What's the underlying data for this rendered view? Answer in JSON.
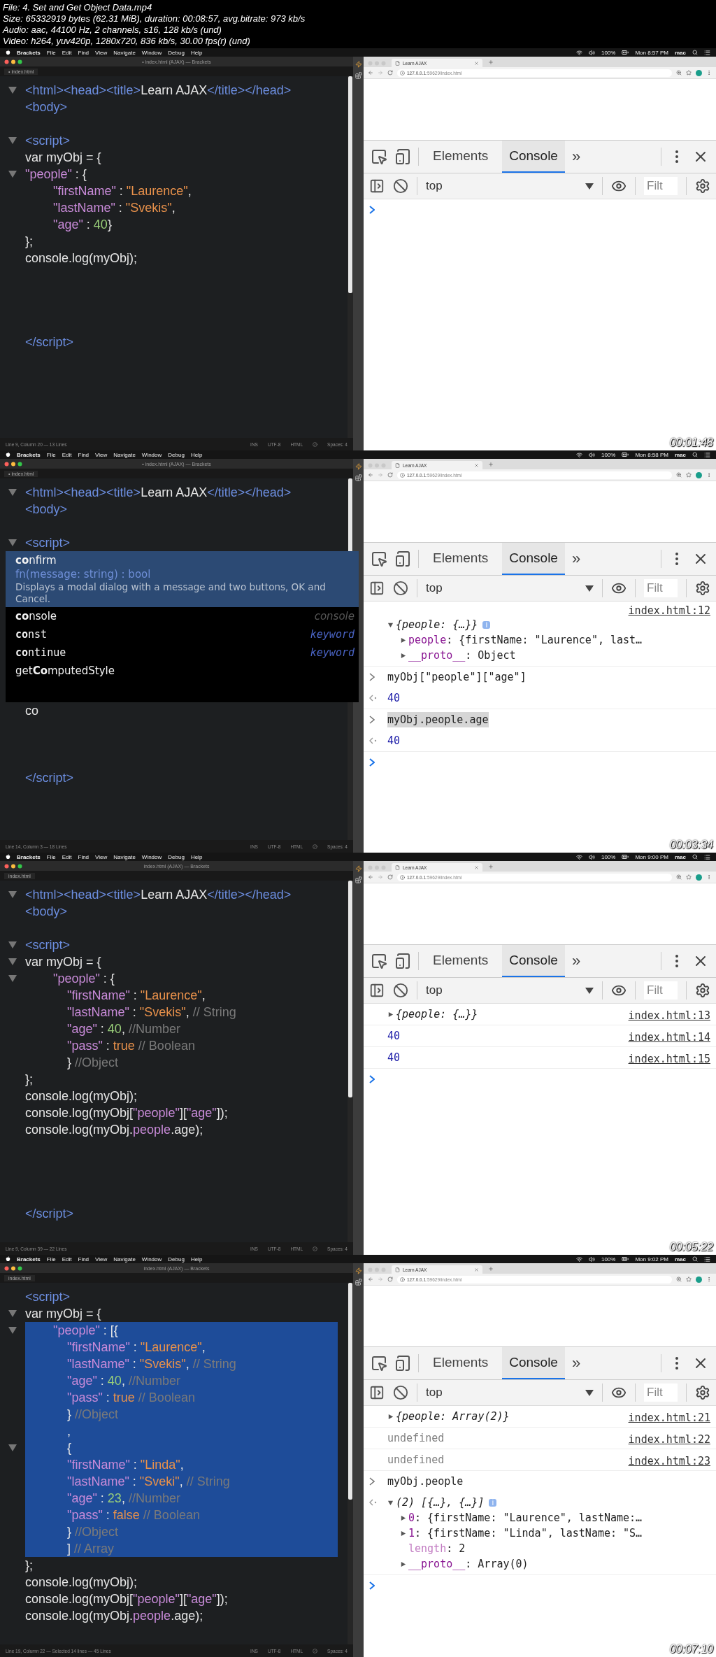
{
  "header": [
    "File: 4. Set and Get Object Data.mp4",
    "Size: 65332919 bytes (62.31 MiB), duration: 00:08:57, avg.bitrate: 973 kb/s",
    "Audio: aac, 44100 Hz, 2 channels, s16, 128 kb/s (und)",
    "Video: h264, yuv420p, 1280x720, 836 kb/s, 30.00 fps(r) (und)"
  ],
  "frames": [
    {
      "menu_bar": {
        "app": "Brackets",
        "menus": [
          "File",
          "Edit",
          "Find",
          "View",
          "Navigate",
          "Window",
          "Debug",
          "Help"
        ],
        "battery": "100%",
        "clock": "Mon 8:57 PM",
        "user": "mac"
      },
      "editor": {
        "title": "• index.html (AJAX) — Brackets",
        "tab": "• index.html",
        "lines": [
          {
            "kind": "code",
            "fold": true,
            "selected": false,
            "tokens": [
              {
                "kind": "tag",
                "text": "<html><head><title>"
              },
              {
                "kind": "text",
                "text": "Learn AJAX"
              },
              {
                "kind": "tag",
                "text": "</title></head>"
              }
            ]
          },
          {
            "kind": "code",
            "fold": false,
            "selected": false,
            "tokens": [
              {
                "kind": "tag",
                "text": "<body>"
              }
            ]
          },
          {
            "kind": "blank"
          },
          {
            "kind": "code",
            "fold": true,
            "selected": false,
            "tokens": [
              {
                "kind": "tag",
                "text": "<script>"
              }
            ]
          },
          {
            "kind": "code",
            "fold": false,
            "selected": false,
            "tokens": [
              {
                "kind": "text",
                "text": "var myObj = {"
              }
            ]
          },
          {
            "kind": "code",
            "fold": true,
            "selected": false,
            "tokens": [
              {
                "kind": "key",
                "text": "\"people\""
              },
              {
                "kind": "text",
                "text": " : {"
              }
            ]
          },
          {
            "kind": "code",
            "fold": false,
            "selected": false,
            "tokens": [
              {
                "kind": "key",
                "text": "        \"firstName\""
              },
              {
                "kind": "text",
                "text": " : "
              },
              {
                "kind": "string",
                "text": "\"Laurence\""
              },
              {
                "kind": "text",
                "text": ","
              }
            ]
          },
          {
            "kind": "code",
            "fold": false,
            "selected": false,
            "tokens": [
              {
                "kind": "key",
                "text": "        \"lastName\""
              },
              {
                "kind": "text",
                "text": " : "
              },
              {
                "kind": "string",
                "text": "\"Svekis\""
              },
              {
                "kind": "text",
                "text": ","
              }
            ]
          },
          {
            "kind": "code",
            "fold": false,
            "selected": false,
            "tokens": [
              {
                "kind": "key",
                "text": "        \"age\""
              },
              {
                "kind": "text",
                "text": " : "
              },
              {
                "kind": "number",
                "text": "40"
              },
              {
                "kind": "text",
                "text": "}"
              }
            ]
          },
          {
            "kind": "code",
            "fold": false,
            "selected": false,
            "tokens": [
              {
                "kind": "text",
                "text": "};"
              }
            ]
          },
          {
            "kind": "code",
            "fold": false,
            "selected": false,
            "tokens": [
              {
                "kind": "text",
                "text": "console.log(myObj);"
              }
            ]
          },
          {
            "kind": "blank"
          },
          {
            "kind": "blank"
          },
          {
            "kind": "blank"
          },
          {
            "kind": "blank"
          },
          {
            "kind": "code",
            "fold": false,
            "selected": false,
            "tokens": [
              {
                "kind": "tag",
                "text": "</script>"
              }
            ]
          }
        ],
        "status": {
          "position": "Line 9, Column 20 — 13 Lines",
          "mode": "INS",
          "encoding": "UTF-8",
          "language": "HTML",
          "indent": "Spaces: 4"
        }
      },
      "browser": {
        "tab": "Learn AJAX",
        "address": "**127.0.0.1**:59629/index.html"
      },
      "devtools": {
        "tabs": [
          {
            "label": "Elements",
            "selected": false
          },
          {
            "label": "Console",
            "selected": true
          }
        ],
        "more": "»",
        "context": "top",
        "filter_placeholder": "Filt",
        "entries": [
          {
            "kind": "prompt"
          }
        ]
      },
      "timestamp": "00:01:48"
    },
    {
      "menu_bar": {
        "app": "Brackets",
        "menus": [
          "File",
          "Edit",
          "Find",
          "View",
          "Navigate",
          "Window",
          "Debug",
          "Help"
        ],
        "battery": "100%",
        "clock": "Mon 8:58 PM",
        "user": "mac"
      },
      "editor": {
        "title": "• index.html (AJAX) — Brackets",
        "tab": "• index.html",
        "lines": [
          {
            "kind": "code",
            "fold": true,
            "selected": false,
            "tokens": [
              {
                "kind": "tag",
                "text": "<html><head><title>"
              },
              {
                "kind": "text",
                "text": "Learn AJAX"
              },
              {
                "kind": "tag",
                "text": "</title></head>"
              }
            ]
          },
          {
            "kind": "code",
            "fold": false,
            "selected": false,
            "tokens": [
              {
                "kind": "tag",
                "text": "<body>"
              }
            ]
          },
          {
            "kind": "blank"
          },
          {
            "kind": "code",
            "fold": true,
            "selected": false,
            "tokens": [
              {
                "kind": "tag",
                "text": "<script>"
              }
            ]
          },
          {
            "kind": "blank"
          },
          {
            "kind": "blank"
          },
          {
            "kind": "blank"
          },
          {
            "kind": "blank"
          },
          {
            "kind": "blank"
          },
          {
            "kind": "blank"
          },
          {
            "kind": "blank"
          },
          {
            "kind": "blank"
          },
          {
            "kind": "blank"
          },
          {
            "kind": "code",
            "fold": false,
            "selected": false,
            "tokens": [
              {
                "kind": "text",
                "text": "co"
              }
            ]
          },
          {
            "kind": "blank"
          },
          {
            "kind": "blank"
          },
          {
            "kind": "blank"
          },
          {
            "kind": "code",
            "fold": false,
            "selected": false,
            "tokens": [
              {
                "kind": "tag",
                "text": "</script>"
              }
            ]
          }
        ],
        "hints": [
          {
            "label": "**co**nfirm",
            "kind": "function",
            "selected": true,
            "signature": "fn(message: string) : bool",
            "doc": "Displays a modal dialog with a message and two buttons, OK and Cancel."
          },
          {
            "label": "**co**nsole",
            "kind": "variable",
            "selected": false,
            "type": "console"
          },
          {
            "label": "**co**nst",
            "kind": "keyword",
            "selected": false,
            "type": "keyword"
          },
          {
            "label": "**co**ntinue",
            "kind": "keyword",
            "selected": false,
            "type": "keyword"
          },
          {
            "label": "get**Co**mputedStyle",
            "kind": "function",
            "selected": false
          }
        ],
        "status": {
          "position": "Line 14, Column 3 — 18 Lines",
          "mode": "INS",
          "encoding": "UTF-8",
          "language": "HTML",
          "indent": "Spaces: 4"
        }
      },
      "browser": {
        "tab": "Learn AJAX",
        "address": "**127.0.0.1**:59629/index.html"
      },
      "devtools": {
        "tabs": [
          {
            "label": "Elements",
            "selected": false
          },
          {
            "label": "Console",
            "selected": true
          }
        ],
        "more": "»",
        "context": "top",
        "filter_placeholder": "Filt",
        "entries": [
          {
            "kind": "log",
            "source": "index.html:12",
            "node": {
              "kind": "object",
              "text": "{people: {…}}",
              "expanded": true,
              "badge": "i",
              "children": [
                {
                  "kind": "property",
                  "key": "people",
                  "text": ": {firstName: \"Laurence\", last…",
                  "expanded": false
                },
                {
                  "kind": "property",
                  "key": "__proto__",
                  "text": ": Object",
                  "expanded": false
                }
              ]
            }
          },
          {
            "kind": "input",
            "text": "myObj[\"people\"][\"age\"]",
            "highlighted": false
          },
          {
            "kind": "result",
            "node": {
              "kind": "number",
              "text": "40"
            }
          },
          {
            "kind": "input",
            "text": "myObj.people.age",
            "highlighted": true
          },
          {
            "kind": "result",
            "node": {
              "kind": "number",
              "text": "40"
            }
          },
          {
            "kind": "prompt"
          }
        ]
      },
      "timestamp": "00:03:34"
    },
    {
      "menu_bar": {
        "app": "Brackets",
        "menus": [
          "File",
          "Edit",
          "Find",
          "View",
          "Navigate",
          "Window",
          "Debug",
          "Help"
        ],
        "battery": "100%",
        "clock": "Mon 9:00 PM",
        "user": "mac"
      },
      "editor": {
        "title": "index.html (AJAX) — Brackets",
        "tab": "index.html",
        "lines": [
          {
            "kind": "code",
            "fold": true,
            "selected": false,
            "tokens": [
              {
                "kind": "tag",
                "text": "<html><head><title>"
              },
              {
                "kind": "text",
                "text": "Learn AJAX"
              },
              {
                "kind": "tag",
                "text": "</title></head>"
              }
            ]
          },
          {
            "kind": "code",
            "fold": false,
            "selected": false,
            "tokens": [
              {
                "kind": "tag",
                "text": "<body>"
              }
            ]
          },
          {
            "kind": "blank"
          },
          {
            "kind": "code",
            "fold": true,
            "selected": false,
            "tokens": [
              {
                "kind": "tag",
                "text": "<script>"
              }
            ]
          },
          {
            "kind": "code",
            "fold": true,
            "selected": false,
            "tokens": [
              {
                "kind": "text",
                "text": "var myObj = {"
              }
            ]
          },
          {
            "kind": "code",
            "fold": true,
            "selected": false,
            "tokens": [
              {
                "kind": "key",
                "text": "        \"people\""
              },
              {
                "kind": "text",
                "text": " : {"
              }
            ]
          },
          {
            "kind": "code",
            "fold": false,
            "selected": false,
            "tokens": [
              {
                "kind": "key",
                "text": "            \"firstName\""
              },
              {
                "kind": "text",
                "text": " : "
              },
              {
                "kind": "string",
                "text": "\"Laurence\""
              },
              {
                "kind": "text",
                "text": ","
              }
            ]
          },
          {
            "kind": "code",
            "fold": false,
            "selected": false,
            "tokens": [
              {
                "kind": "key",
                "text": "            \"lastName\""
              },
              {
                "kind": "text",
                "text": " : "
              },
              {
                "kind": "string",
                "text": "\"Svekis\""
              },
              {
                "kind": "text",
                "text": ", "
              },
              {
                "kind": "comment",
                "text": "// String"
              }
            ]
          },
          {
            "kind": "code",
            "fold": false,
            "selected": false,
            "tokens": [
              {
                "kind": "key",
                "text": "            \"age\""
              },
              {
                "kind": "text",
                "text": " : "
              },
              {
                "kind": "number",
                "text": "40"
              },
              {
                "kind": "text",
                "text": ", "
              },
              {
                "kind": "comment",
                "text": "//Number"
              }
            ]
          },
          {
            "kind": "code",
            "fold": false,
            "selected": false,
            "tokens": [
              {
                "kind": "key",
                "text": "            \"pass\""
              },
              {
                "kind": "text",
                "text": " : "
              },
              {
                "kind": "atom",
                "text": "true"
              },
              {
                "kind": "comment",
                "text": " // Boolean"
              }
            ]
          },
          {
            "kind": "code",
            "fold": false,
            "selected": false,
            "tokens": [
              {
                "kind": "text",
                "text": "            } "
              },
              {
                "kind": "comment",
                "text": "//Object"
              }
            ]
          },
          {
            "kind": "code",
            "fold": false,
            "selected": false,
            "tokens": [
              {
                "kind": "text",
                "text": "};"
              }
            ]
          },
          {
            "kind": "code",
            "fold": false,
            "selected": false,
            "tokens": [
              {
                "kind": "text",
                "text": "console.log(myObj);"
              }
            ]
          },
          {
            "kind": "code",
            "fold": false,
            "selected": false,
            "tokens": [
              {
                "kind": "text",
                "text": "console.log(myObj["
              },
              {
                "kind": "key",
                "text": "\"people\""
              },
              {
                "kind": "text",
                "text": "]["
              },
              {
                "kind": "key",
                "text": "\"age\""
              },
              {
                "kind": "text",
                "text": "]);"
              }
            ]
          },
          {
            "kind": "code",
            "fold": false,
            "selected": false,
            "tokens": [
              {
                "kind": "text",
                "text": "console.log(myObj."
              },
              {
                "kind": "key",
                "text": "people"
              },
              {
                "kind": "text",
                "text": ".age);"
              }
            ]
          },
          {
            "kind": "blank"
          },
          {
            "kind": "blank"
          },
          {
            "kind": "blank"
          },
          {
            "kind": "blank"
          },
          {
            "kind": "code",
            "fold": false,
            "selected": false,
            "tokens": [
              {
                "kind": "tag",
                "text": "</script>"
              }
            ]
          }
        ],
        "status": {
          "position": "Line 9, Column 39 — 22 Lines",
          "mode": "INS",
          "encoding": "UTF-8",
          "language": "HTML",
          "indent": "Spaces: 4"
        }
      },
      "browser": {
        "tab": "Learn AJAX",
        "address": "**127.0.0.1**:59629/index.html"
      },
      "devtools": {
        "tabs": [
          {
            "label": "Elements",
            "selected": false
          },
          {
            "label": "Console",
            "selected": true
          }
        ],
        "more": "»",
        "context": "top",
        "filter_placeholder": "Filt",
        "entries": [
          {
            "kind": "log",
            "source": "index.html:13",
            "node": {
              "kind": "object",
              "text": "{people: {…}}",
              "expanded": false
            }
          },
          {
            "kind": "log",
            "source": "index.html:14",
            "node": {
              "kind": "number",
              "text": "40"
            }
          },
          {
            "kind": "log",
            "source": "index.html:15",
            "node": {
              "kind": "number",
              "text": "40"
            }
          },
          {
            "kind": "prompt"
          }
        ]
      },
      "timestamp": "00:05:22"
    },
    {
      "menu_bar": {
        "app": "Brackets",
        "menus": [
          "File",
          "Edit",
          "Find",
          "View",
          "Navigate",
          "Window",
          "Debug",
          "Help"
        ],
        "battery": "100%",
        "clock": "Mon 9:02 PM",
        "user": "mac"
      },
      "editor": {
        "title": "index.html (AJAX) — Brackets",
        "tab": "index.html",
        "lines": [
          {
            "kind": "code",
            "fold": false,
            "selected": false,
            "tokens": [
              {
                "kind": "tag",
                "text": "<script>"
              }
            ]
          },
          {
            "kind": "code",
            "fold": true,
            "selected": false,
            "tokens": [
              {
                "kind": "text",
                "text": "var myObj = {"
              }
            ]
          },
          {
            "kind": "code",
            "fold": true,
            "selected": true,
            "tokens": [
              {
                "kind": "key",
                "text": "        \"people\""
              },
              {
                "kind": "text",
                "text": " : [{"
              }
            ]
          },
          {
            "kind": "code",
            "fold": false,
            "selected": true,
            "tokens": [
              {
                "kind": "key",
                "text": "            \"firstName\""
              },
              {
                "kind": "text",
                "text": " : "
              },
              {
                "kind": "string",
                "text": "\"Laurence\""
              },
              {
                "kind": "text",
                "text": ","
              }
            ]
          },
          {
            "kind": "code",
            "fold": false,
            "selected": true,
            "tokens": [
              {
                "kind": "key",
                "text": "            \"lastName\""
              },
              {
                "kind": "text",
                "text": " : "
              },
              {
                "kind": "string",
                "text": "\"Svekis\""
              },
              {
                "kind": "text",
                "text": ", "
              },
              {
                "kind": "comment",
                "text": "// String"
              }
            ]
          },
          {
            "kind": "code",
            "fold": false,
            "selected": true,
            "tokens": [
              {
                "kind": "key",
                "text": "            \"age\""
              },
              {
                "kind": "text",
                "text": " : "
              },
              {
                "kind": "number",
                "text": "40"
              },
              {
                "kind": "text",
                "text": ", "
              },
              {
                "kind": "comment",
                "text": "//Number"
              }
            ]
          },
          {
            "kind": "code",
            "fold": false,
            "selected": true,
            "tokens": [
              {
                "kind": "key",
                "text": "            \"pass\""
              },
              {
                "kind": "text",
                "text": " : "
              },
              {
                "kind": "atom",
                "text": "true"
              },
              {
                "kind": "comment",
                "text": " // Boolean"
              }
            ]
          },
          {
            "kind": "code",
            "fold": false,
            "selected": true,
            "tokens": [
              {
                "kind": "text",
                "text": "            } "
              },
              {
                "kind": "comment",
                "text": "//Object"
              }
            ]
          },
          {
            "kind": "code",
            "fold": false,
            "selected": true,
            "tokens": [
              {
                "kind": "text",
                "text": "            ,"
              }
            ]
          },
          {
            "kind": "code",
            "fold": true,
            "selected": true,
            "tokens": [
              {
                "kind": "text",
                "text": "            {"
              }
            ]
          },
          {
            "kind": "code",
            "fold": false,
            "selected": true,
            "tokens": [
              {
                "kind": "key",
                "text": "            \"firstName\""
              },
              {
                "kind": "text",
                "text": " : "
              },
              {
                "kind": "string",
                "text": "\"Linda\""
              },
              {
                "kind": "text",
                "text": ","
              }
            ]
          },
          {
            "kind": "code",
            "fold": false,
            "selected": true,
            "tokens": [
              {
                "kind": "key",
                "text": "            \"lastName\""
              },
              {
                "kind": "text",
                "text": " : "
              },
              {
                "kind": "string",
                "text": "\"Sveki\""
              },
              {
                "kind": "text",
                "text": ", "
              },
              {
                "kind": "comment",
                "text": "// String"
              }
            ]
          },
          {
            "kind": "code",
            "fold": false,
            "selected": true,
            "tokens": [
              {
                "kind": "key",
                "text": "            \"age\""
              },
              {
                "kind": "text",
                "text": " : "
              },
              {
                "kind": "number",
                "text": "23"
              },
              {
                "kind": "text",
                "text": ", "
              },
              {
                "kind": "comment",
                "text": "//Number"
              }
            ]
          },
          {
            "kind": "code",
            "fold": false,
            "selected": true,
            "tokens": [
              {
                "kind": "key",
                "text": "            \"pass\""
              },
              {
                "kind": "text",
                "text": " : "
              },
              {
                "kind": "atom",
                "text": "false"
              },
              {
                "kind": "comment",
                "text": " // Boolean"
              }
            ]
          },
          {
            "kind": "code",
            "fold": false,
            "selected": true,
            "tokens": [
              {
                "kind": "text",
                "text": "            } "
              },
              {
                "kind": "comment",
                "text": "//Object"
              }
            ]
          },
          {
            "kind": "code",
            "fold": false,
            "selected": true,
            "tokens": [
              {
                "kind": "text",
                "text": "            ] "
              },
              {
                "kind": "comment",
                "text": "// Array"
              }
            ]
          },
          {
            "kind": "code",
            "fold": false,
            "selected": false,
            "tokens": [
              {
                "kind": "text",
                "text": "};"
              }
            ]
          },
          {
            "kind": "code",
            "fold": false,
            "selected": false,
            "tokens": [
              {
                "kind": "text",
                "text": "console.log(myObj);"
              }
            ]
          },
          {
            "kind": "code",
            "fold": false,
            "selected": false,
            "tokens": [
              {
                "kind": "text",
                "text": "console.log(myObj["
              },
              {
                "kind": "key",
                "text": "\"people\""
              },
              {
                "kind": "text",
                "text": "]["
              },
              {
                "kind": "key",
                "text": "\"age\""
              },
              {
                "kind": "text",
                "text": "]);"
              }
            ]
          },
          {
            "kind": "code",
            "fold": false,
            "selected": false,
            "tokens": [
              {
                "kind": "text",
                "text": "console.log(myObj."
              },
              {
                "kind": "key",
                "text": "people"
              },
              {
                "kind": "text",
                "text": ".age);"
              }
            ]
          }
        ],
        "status": {
          "position": "Line 19, Column 22 — Selected 14 lines — 45 Lines",
          "mode": "INS",
          "encoding": "UTF-8",
          "language": "HTML",
          "indent": "Spaces: 4"
        }
      },
      "browser": {
        "tab": "Learn AJAX",
        "address": "**127.0.0.1**:59629/index.html"
      },
      "devtools": {
        "tabs": [
          {
            "label": "Elements",
            "selected": false
          },
          {
            "label": "Console",
            "selected": true
          }
        ],
        "more": "»",
        "context": "top",
        "filter_placeholder": "Filt",
        "entries": [
          {
            "kind": "log",
            "source": "index.html:21",
            "node": {
              "kind": "object",
              "text": "{people: Array(2)}",
              "expanded": false
            }
          },
          {
            "kind": "log",
            "source": "index.html:22",
            "node": {
              "kind": "undefined",
              "text": "undefined"
            }
          },
          {
            "kind": "log",
            "source": "index.html:23",
            "node": {
              "kind": "undefined",
              "text": "undefined"
            }
          },
          {
            "kind": "input",
            "text": "myObj.people",
            "highlighted": false
          },
          {
            "kind": "result",
            "node": {
              "kind": "object",
              "text": "(2) [{…}, {…}]",
              "expanded": true,
              "badge": "i",
              "children": [
                {
                  "kind": "property",
                  "key": "0",
                  "text": ": {firstName: \"Laurence\", lastName:…",
                  "expanded": false
                },
                {
                  "kind": "property",
                  "key": "1",
                  "text": ": {firstName: \"Linda\", lastName: \"S…",
                  "expanded": false
                },
                {
                  "kind": "field",
                  "key": "length",
                  "text": ": 2"
                },
                {
                  "kind": "property",
                  "key": "__proto__",
                  "text": ": Array(0)",
                  "expanded": false
                }
              ]
            }
          },
          {
            "kind": "prompt"
          }
        ]
      },
      "timestamp": "00:07:10"
    }
  ]
}
